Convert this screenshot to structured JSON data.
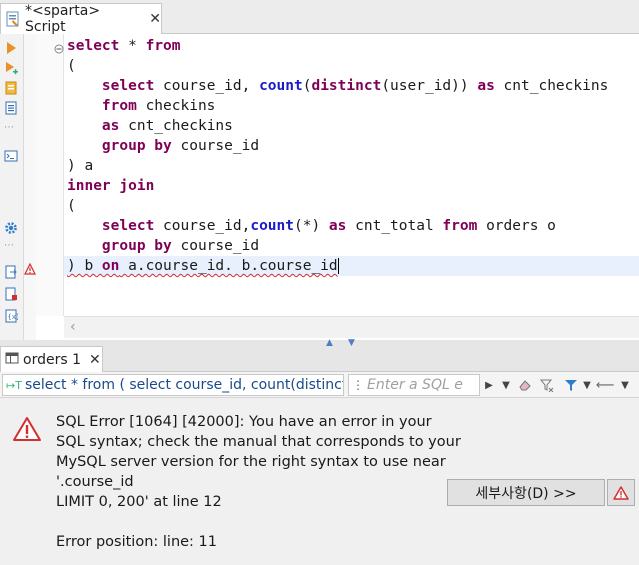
{
  "editor_tab": {
    "title": "*<sparta> Script",
    "close_glyph": "✕"
  },
  "code_lines": [
    {
      "parts": [
        [
          "kw",
          "select"
        ],
        [
          "t",
          " * "
        ],
        [
          "kw",
          "from"
        ]
      ]
    },
    {
      "parts": [
        [
          "t",
          "("
        ]
      ]
    },
    {
      "parts": [
        [
          "t",
          "    "
        ],
        [
          "kw",
          "select"
        ],
        [
          "t",
          " course_id, "
        ],
        [
          "fn",
          "count"
        ],
        [
          "t",
          "("
        ],
        [
          "kw",
          "distinct"
        ],
        [
          "t",
          "(user_id)) "
        ],
        [
          "kw",
          "as"
        ],
        [
          "t",
          " cnt_checkins"
        ]
      ]
    },
    {
      "parts": [
        [
          "t",
          "    "
        ],
        [
          "kw",
          "from"
        ],
        [
          "t",
          " checkins"
        ]
      ]
    },
    {
      "parts": [
        [
          "t",
          "    "
        ],
        [
          "kw",
          "as"
        ],
        [
          "t",
          " cnt_checkins"
        ]
      ]
    },
    {
      "parts": [
        [
          "t",
          "    "
        ],
        [
          "kw",
          "group by"
        ],
        [
          "t",
          " course_id"
        ]
      ]
    },
    {
      "parts": [
        [
          "t",
          ") a"
        ]
      ]
    },
    {
      "parts": [
        [
          "kw",
          "inner join"
        ]
      ]
    },
    {
      "parts": [
        [
          "t",
          "("
        ]
      ]
    },
    {
      "parts": [
        [
          "t",
          "    "
        ],
        [
          "kw",
          "select"
        ],
        [
          "t",
          " course_id,"
        ],
        [
          "fn",
          "count"
        ],
        [
          "t",
          "(*) "
        ],
        [
          "kw",
          "as"
        ],
        [
          "t",
          " cnt_total "
        ],
        [
          "kw",
          "from"
        ],
        [
          "t",
          " orders o"
        ]
      ]
    },
    {
      "parts": [
        [
          "t",
          "    "
        ],
        [
          "kw",
          "group by"
        ],
        [
          "t",
          " course_id"
        ]
      ]
    },
    {
      "parts": [
        [
          "sq",
          ") b "
        ],
        [
          "sqkw",
          "on"
        ],
        [
          "sq",
          " a.course_id. b.course_id"
        ]
      ]
    }
  ],
  "result_tab": {
    "title": "orders 1",
    "close_glyph": "✕"
  },
  "query_text": "select * from ( select course_id, count(distinct(user_id)) as cnt_checkins from checkins",
  "filter": {
    "placeholder": "Enter a SQL e"
  },
  "error": {
    "lines": [
      "SQL Error [1064] [42000]: You have an error in your",
      "SQL syntax; check the manual that corresponds to your",
      "MySQL server version for the right syntax to use near",
      "'.course_id",
      "LIMIT 0, 200' at line 12",
      "",
      "Error position: line: 11"
    ],
    "details_button": "세부사항(D) >>"
  },
  "colors": {
    "keyword": "#7f0055",
    "function": "#1a1acc",
    "error": "#d32f2f",
    "accent": "#4a7fc1"
  },
  "icons": [
    "sql-file-icon",
    "run-statement-icon",
    "run-script-icon",
    "explain-plan-icon",
    "load-plan-icon",
    "open-console-icon",
    "settings-gear-icon",
    "export-icon",
    "import-icon",
    "format-icon",
    "warning-icon",
    "filter-icon",
    "history-icon",
    "back-arrow-icon",
    "menu-icon"
  ]
}
